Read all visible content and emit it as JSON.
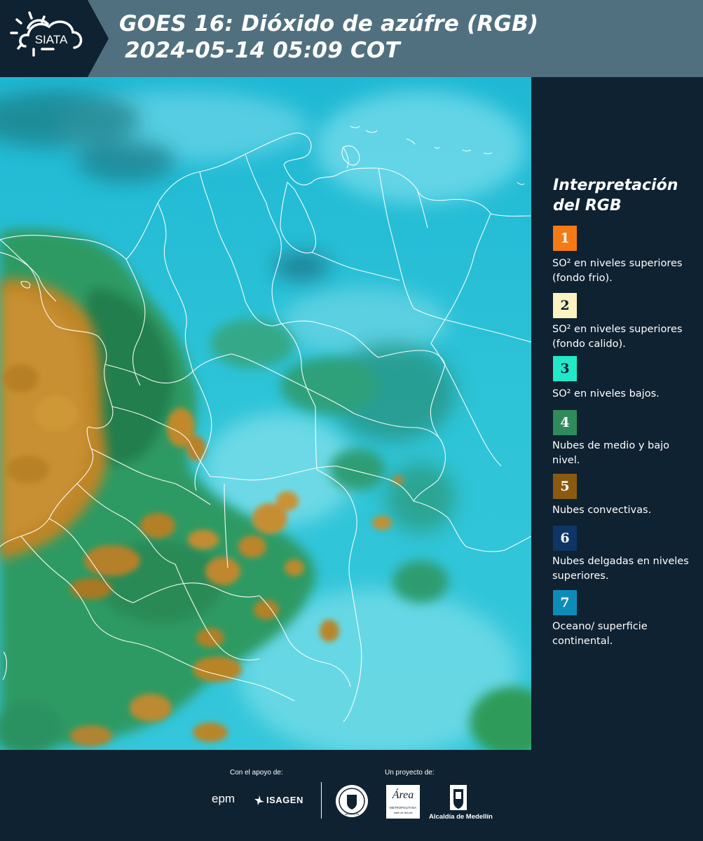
{
  "header": {
    "logo_text": "SIATA",
    "title_line1": "GOES 16: Dióxido de azúfre (RGB)",
    "title_line2": "2024-05-14 05:09 COT"
  },
  "legend": {
    "title_line1": "Interpretación",
    "title_line2": "del RGB",
    "items": [
      {
        "number": "1",
        "color": "#f47a16",
        "text": "SO² en niveles superiores (fondo frio)."
      },
      {
        "number": "2",
        "color": "#fbf3c0",
        "text": "SO² en niveles superiores (fondo calido)."
      },
      {
        "number": "3",
        "color": "#22e8c8",
        "text": "SO² en niveles bajos."
      },
      {
        "number": "4",
        "color": "#2f8a5c",
        "text": "Nubes de medio y bajo nivel."
      },
      {
        "number": "5",
        "color": "#8a5a10",
        "text": "Nubes convectivas."
      },
      {
        "number": "6",
        "color": "#0d3566",
        "text": "Nubes delgadas en niveles superiores."
      },
      {
        "number": "7",
        "color": "#0e8cb8",
        "text": "Oceano/ superficie continental."
      }
    ]
  },
  "footer": {
    "support_label": "Con el apoyo de:",
    "project_label": "Un proyecto de:",
    "sponsor1": "epm",
    "sponsor2": "ISAGEN",
    "org1_name": "Área",
    "org1_sub1": "METROPOLITANA",
    "org1_sub2": "Valle de Aburrá",
    "org2_name": "Alcaldía de Medellín",
    "seal_text": "MEDELLÍN"
  }
}
